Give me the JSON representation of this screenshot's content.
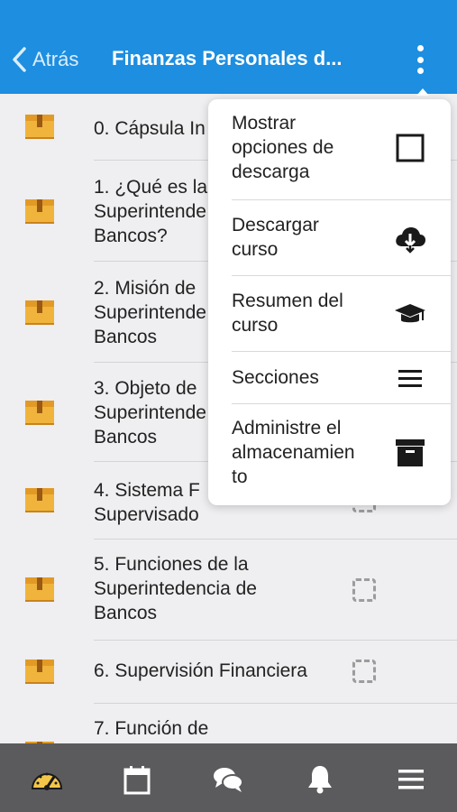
{
  "header": {
    "back_label": "Atrás",
    "title": "Finanzas Personales d..."
  },
  "sections": [
    {
      "lines": [
        "0. Cápsula In"
      ]
    },
    {
      "lines": [
        "1. ¿Qué es la",
        "Superintende",
        "Bancos?"
      ]
    },
    {
      "lines": [
        "2. Misión de",
        "Superintende",
        "Bancos"
      ]
    },
    {
      "lines": [
        "3. Objeto de",
        "Superintende",
        "Bancos"
      ]
    },
    {
      "lines": [
        "4. Sistema F",
        "Supervisado"
      ]
    },
    {
      "lines": [
        "5. Funciones de la",
        "Superintedencia de",
        "Bancos"
      ]
    },
    {
      "lines": [
        "6. Supervisión Financiera"
      ]
    },
    {
      "lines": [
        "7. Función de"
      ]
    }
  ],
  "menu": {
    "items": [
      {
        "lines": [
          "Mostrar",
          "opciones de",
          "descarga"
        ],
        "icon": "checkbox-icon"
      },
      {
        "lines": [
          "Descargar",
          "curso"
        ],
        "icon": "cloud-download-icon"
      },
      {
        "lines": [
          "Resumen del",
          "curso"
        ],
        "icon": "graduation-cap-icon"
      },
      {
        "lines": [
          "Secciones"
        ],
        "icon": "hamburger-icon"
      },
      {
        "lines": [
          "Administre el",
          "almacenamien",
          "to"
        ],
        "icon": "archive-icon"
      }
    ]
  },
  "tabbar": {
    "items": [
      {
        "icon": "dashboard-icon",
        "color": "#f3c64a"
      },
      {
        "icon": "calendar-icon",
        "color": "#ffffff"
      },
      {
        "icon": "chat-icon",
        "color": "#ffffff"
      },
      {
        "icon": "bell-icon",
        "color": "#ffffff"
      },
      {
        "icon": "menu-icon",
        "color": "#ffffff"
      }
    ]
  },
  "colors": {
    "header": "#1d8ee0",
    "tabbar": "#5b5b5d",
    "box": "#f0b43c"
  }
}
